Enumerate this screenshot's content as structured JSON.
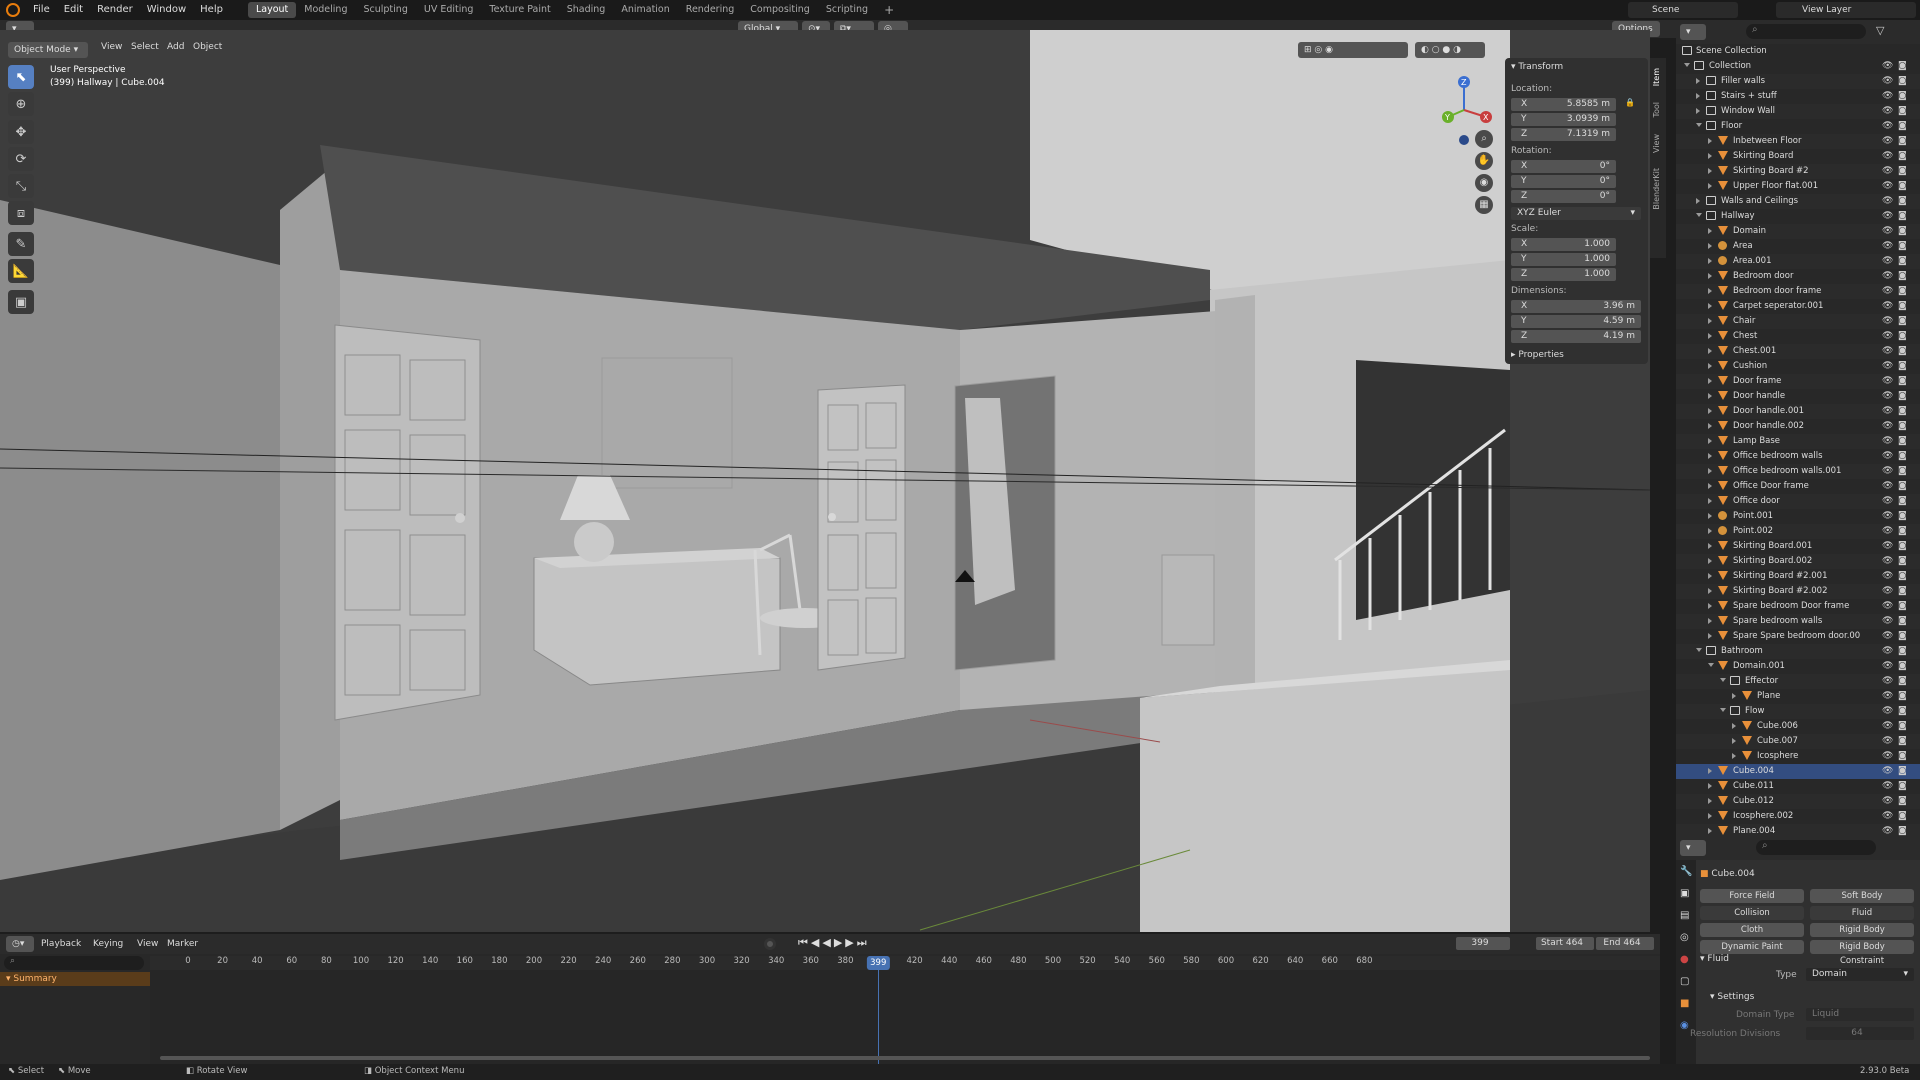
{
  "topbar": {
    "menus": [
      "File",
      "Edit",
      "Render",
      "Window",
      "Help"
    ],
    "workspaces": [
      "Layout",
      "Modeling",
      "Sculpting",
      "UV Editing",
      "Texture Paint",
      "Shading",
      "Animation",
      "Rendering",
      "Compositing",
      "Scripting"
    ],
    "active_workspace": "Layout",
    "scene": "Scene",
    "view_layer": "View Layer"
  },
  "viewport_header": {
    "mode": "Object Mode",
    "menus": [
      "View",
      "Select",
      "Add",
      "Object"
    ],
    "transform_orientation": "Global",
    "options": "Options"
  },
  "viewport": {
    "perspective": "User Perspective",
    "active": "(399) Hallway | Cube.004",
    "axis_x": "X",
    "axis_y": "Y",
    "axis_z": "Z"
  },
  "npanel": {
    "tabs": [
      "Item",
      "Tool",
      "View",
      "BlenderKit"
    ],
    "section": "Transform",
    "location_label": "Location:",
    "location": {
      "x": "5.8585 m",
      "y": "3.0939 m",
      "z": "7.1319 m"
    },
    "rotation_label": "Rotation:",
    "rotation": {
      "x": "0°",
      "y": "0°",
      "z": "0°"
    },
    "rotation_mode": "XYZ Euler",
    "scale_label": "Scale:",
    "scale": {
      "x": "1.000",
      "y": "1.000",
      "z": "1.000"
    },
    "dimensions_label": "Dimensions:",
    "dimensions": {
      "x": "3.96 m",
      "y": "4.59 m",
      "z": "4.19 m"
    },
    "properties": "Properties",
    "x": "X",
    "y": "Y",
    "z": "Z"
  },
  "outliner": {
    "root": "Scene Collection",
    "rows": [
      {
        "name": "Collection",
        "depth": 0,
        "kind": "coll",
        "open": true
      },
      {
        "name": "Filler walls",
        "depth": 1,
        "kind": "coll",
        "open": false
      },
      {
        "name": "Stairs + stuff",
        "depth": 1,
        "kind": "coll",
        "open": false
      },
      {
        "name": "Window Wall",
        "depth": 1,
        "kind": "coll",
        "open": false
      },
      {
        "name": "Floor",
        "depth": 1,
        "kind": "coll",
        "open": true
      },
      {
        "name": "Inbetween Floor",
        "depth": 2,
        "kind": "obj",
        "open": false
      },
      {
        "name": "Skirting Board",
        "depth": 2,
        "kind": "obj",
        "open": false
      },
      {
        "name": "Skirting Board #2",
        "depth": 2,
        "kind": "obj",
        "open": false
      },
      {
        "name": "Upper Floor flat.001",
        "depth": 2,
        "kind": "obj",
        "open": false
      },
      {
        "name": "Walls and Ceilings",
        "depth": 1,
        "kind": "coll",
        "open": false
      },
      {
        "name": "Hallway",
        "depth": 1,
        "kind": "coll",
        "open": true
      },
      {
        "name": "Domain",
        "depth": 2,
        "kind": "obj",
        "open": false
      },
      {
        "name": "Area",
        "depth": 2,
        "kind": "lamp",
        "open": false
      },
      {
        "name": "Area.001",
        "depth": 2,
        "kind": "lamp",
        "open": false
      },
      {
        "name": "Bedroom door",
        "depth": 2,
        "kind": "obj",
        "open": false
      },
      {
        "name": "Bedroom door frame",
        "depth": 2,
        "kind": "obj",
        "open": false
      },
      {
        "name": "Carpet seperator.001",
        "depth": 2,
        "kind": "obj",
        "open": false
      },
      {
        "name": "Chair",
        "depth": 2,
        "kind": "obj",
        "open": false
      },
      {
        "name": "Chest",
        "depth": 2,
        "kind": "obj",
        "open": false
      },
      {
        "name": "Chest.001",
        "depth": 2,
        "kind": "obj",
        "open": false
      },
      {
        "name": "Cushion",
        "depth": 2,
        "kind": "obj",
        "open": false
      },
      {
        "name": "Door frame",
        "depth": 2,
        "kind": "obj",
        "open": false
      },
      {
        "name": "Door handle",
        "depth": 2,
        "kind": "obj",
        "open": false
      },
      {
        "name": "Door handle.001",
        "depth": 2,
        "kind": "obj",
        "open": false
      },
      {
        "name": "Door handle.002",
        "depth": 2,
        "kind": "obj",
        "open": false
      },
      {
        "name": "Lamp Base",
        "depth": 2,
        "kind": "obj",
        "open": false
      },
      {
        "name": "Office bedroom walls",
        "depth": 2,
        "kind": "obj",
        "open": false
      },
      {
        "name": "Office bedroom walls.001",
        "depth": 2,
        "kind": "obj",
        "open": false
      },
      {
        "name": "Office Door frame",
        "depth": 2,
        "kind": "obj",
        "open": false
      },
      {
        "name": "Office door",
        "depth": 2,
        "kind": "obj",
        "open": false
      },
      {
        "name": "Point.001",
        "depth": 2,
        "kind": "lamp",
        "open": false
      },
      {
        "name": "Point.002",
        "depth": 2,
        "kind": "lamp",
        "open": false
      },
      {
        "name": "Skirting Board.001",
        "depth": 2,
        "kind": "obj",
        "open": false
      },
      {
        "name": "Skirting Board.002",
        "depth": 2,
        "kind": "obj",
        "open": false
      },
      {
        "name": "Skirting Board #2.001",
        "depth": 2,
        "kind": "obj",
        "open": false
      },
      {
        "name": "Skirting Board #2.002",
        "depth": 2,
        "kind": "obj",
        "open": false
      },
      {
        "name": "Spare bedroom Door frame",
        "depth": 2,
        "kind": "obj",
        "open": false
      },
      {
        "name": "Spare bedroom walls",
        "depth": 2,
        "kind": "obj",
        "open": false
      },
      {
        "name": "Spare Spare bedroom door.00",
        "depth": 2,
        "kind": "obj",
        "open": false
      },
      {
        "name": "Bathroom",
        "depth": 1,
        "kind": "coll",
        "open": true
      },
      {
        "name": "Domain.001",
        "depth": 2,
        "kind": "obj",
        "open": true
      },
      {
        "name": "Effector",
        "depth": 3,
        "kind": "coll",
        "open": true
      },
      {
        "name": "Plane",
        "depth": 4,
        "kind": "obj",
        "open": false
      },
      {
        "name": "Flow",
        "depth": 3,
        "kind": "coll",
        "open": true
      },
      {
        "name": "Cube.006",
        "depth": 4,
        "kind": "obj",
        "open": false
      },
      {
        "name": "Cube.007",
        "depth": 4,
        "kind": "obj",
        "open": false
      },
      {
        "name": "Icosphere",
        "depth": 4,
        "kind": "obj",
        "open": false
      },
      {
        "name": "Cube.004",
        "depth": 2,
        "kind": "obj",
        "open": false,
        "selected": true
      },
      {
        "name": "Cube.011",
        "depth": 2,
        "kind": "obj",
        "open": false
      },
      {
        "name": "Cube.012",
        "depth": 2,
        "kind": "obj",
        "open": false
      },
      {
        "name": "Icosphere.002",
        "depth": 2,
        "kind": "obj",
        "open": false
      },
      {
        "name": "Plane.004",
        "depth": 2,
        "kind": "obj",
        "open": false
      }
    ]
  },
  "properties": {
    "object": "Cube.004",
    "physics_buttons": [
      "Force Field",
      "Soft Body",
      "Collision",
      "Fluid",
      "Cloth",
      "Rigid Body",
      "Dynamic Paint",
      "Rigid Body Constraint"
    ],
    "fluid_section": "Fluid",
    "type_label": "Type",
    "type_value": "Domain",
    "settings_section": "Settings",
    "domain_type_label": "Domain Type",
    "domain_type_value": "Liquid",
    "resolution_label": "Resolution Divisions",
    "resolution_value": "64"
  },
  "timeline": {
    "menus": [
      "Playback",
      "Keying",
      "View",
      "Marker"
    ],
    "current_frame": "399",
    "start_label": "Start",
    "start": "464",
    "end_label": "End",
    "end": "464",
    "ticks": [
      "0",
      "20",
      "40",
      "60",
      "80",
      "100",
      "120",
      "140",
      "160",
      "180",
      "200",
      "220",
      "240",
      "260",
      "280",
      "300",
      "320",
      "340",
      "360",
      "380",
      "400",
      "420",
      "440",
      "460",
      "480",
      "500",
      "520",
      "540",
      "560",
      "580",
      "600",
      "620",
      "640",
      "660",
      "680"
    ],
    "summary": "Summary",
    "playhead": 399
  },
  "statusbar": {
    "items": [
      "Select",
      "Move",
      "Rotate View",
      "Object Context Menu"
    ],
    "version": "2.93.0 Beta"
  }
}
